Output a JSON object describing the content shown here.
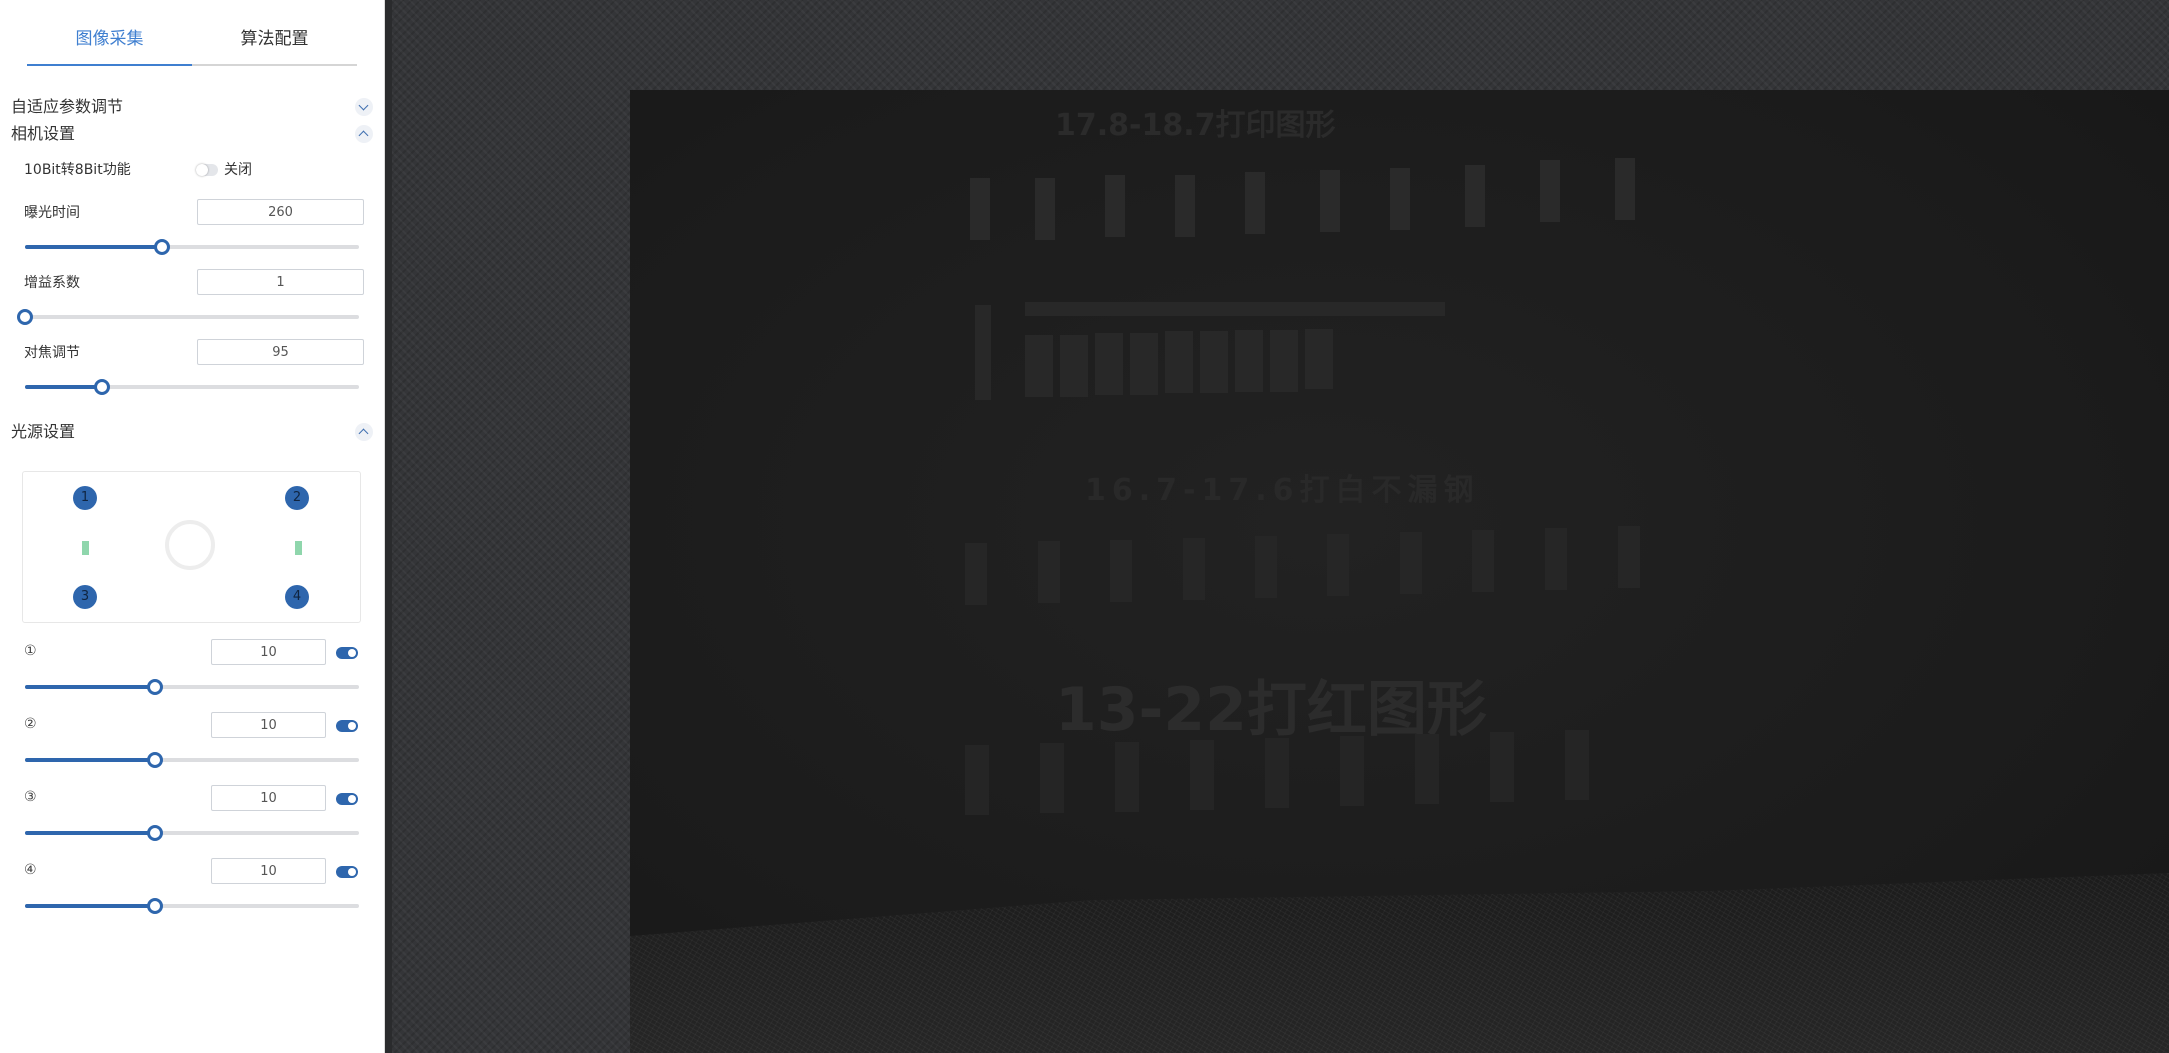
{
  "tabs": [
    {
      "label": "图像采集",
      "active": true
    },
    {
      "label": "算法配置",
      "active": false
    }
  ],
  "sections": {
    "adaptive": {
      "label": "自适应参数调节",
      "expanded": false
    },
    "camera": {
      "label": "相机设置",
      "expanded": true
    },
    "light": {
      "label": "光源设置",
      "expanded": true
    }
  },
  "camera": {
    "bit_convert": {
      "label": "10Bit转8Bit功能",
      "state_label": "关闭",
      "on": false
    },
    "exposure": {
      "label": "曝光时间",
      "value": "260",
      "slider_fraction": 0.41
    },
    "gain": {
      "label": "增益系数",
      "value": "1",
      "slider_fraction": 0.0
    },
    "focus": {
      "label": "对焦调节",
      "value": "95",
      "slider_fraction": 0.23
    }
  },
  "light": {
    "diagram": {
      "dots": [
        "1",
        "2",
        "3",
        "4"
      ]
    },
    "channels": [
      {
        "label": "①",
        "value": "10",
        "enabled": true,
        "slider_fraction": 0.39
      },
      {
        "label": "②",
        "value": "10",
        "enabled": true,
        "slider_fraction": 0.39
      },
      {
        "label": "③",
        "value": "10",
        "enabled": true,
        "slider_fraction": 0.39
      },
      {
        "label": "④",
        "value": "10",
        "enabled": true,
        "slider_fraction": 0.39
      }
    ]
  },
  "camera_image": {
    "texts": [
      "17.8-18.7打印图形",
      "16.7-17.6打白不漏钢",
      "13-22打红图形"
    ]
  },
  "colors": {
    "accent": "#2e66ad",
    "tab_active": "#3f7fd0",
    "light_indicator": "#8fd6ac"
  }
}
